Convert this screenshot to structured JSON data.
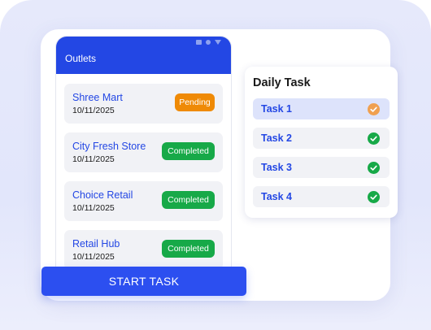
{
  "phone": {
    "header_title": "Outlets"
  },
  "outlets": [
    {
      "name": "Shree Mart",
      "date": "10/11/2025",
      "status": "Pending"
    },
    {
      "name": "City Fresh Store",
      "date": "10/11/2025",
      "status": "Completed"
    },
    {
      "name": "Choice Retail",
      "date": "10/11/2025",
      "status": "Completed"
    },
    {
      "name": "Retail Hub",
      "date": "10/11/2025",
      "status": "Completed"
    }
  ],
  "start_button": {
    "label": "START TASK"
  },
  "daily_task": {
    "title": "Daily Task",
    "tasks": [
      {
        "label": "Task 1",
        "icon": "check-circle-icon",
        "color": "#f0a050"
      },
      {
        "label": "Task 2",
        "icon": "check-circle-icon",
        "color": "#17a948"
      },
      {
        "label": "Task 3",
        "icon": "check-circle-icon",
        "color": "#17a948"
      },
      {
        "label": "Task 4",
        "icon": "check-circle-icon",
        "color": "#17a948"
      }
    ]
  },
  "colors": {
    "primary": "#2347e4",
    "pending": "#ef8a06",
    "completed": "#17a948"
  }
}
